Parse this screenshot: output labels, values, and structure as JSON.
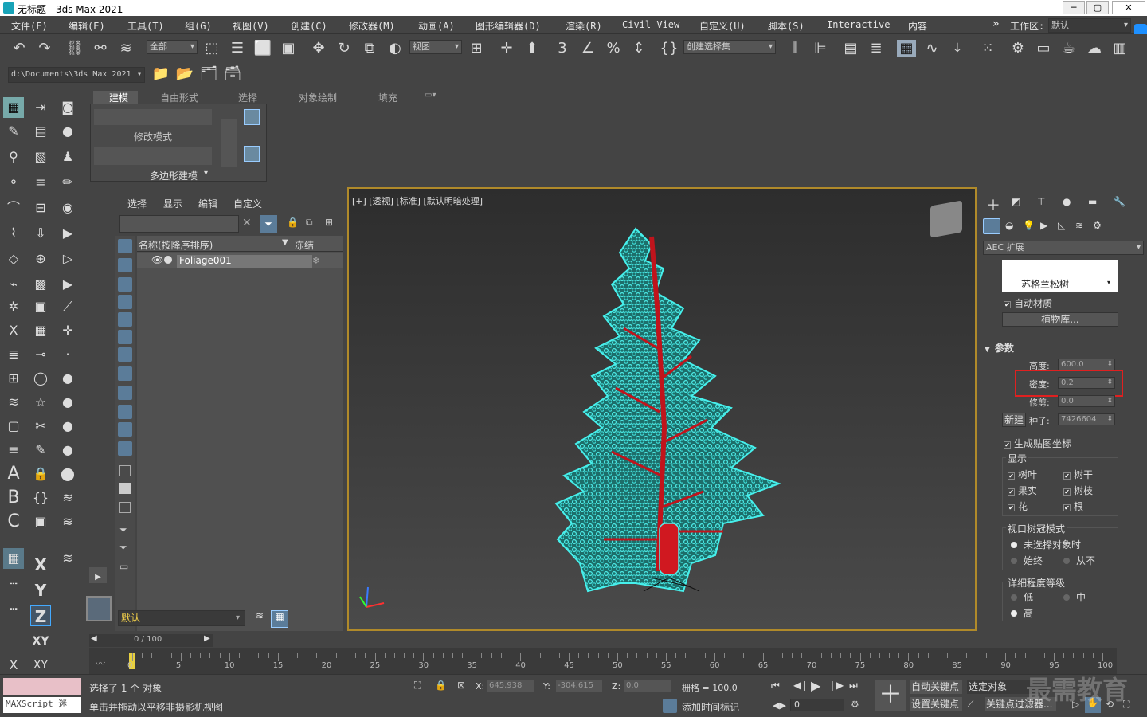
{
  "window": {
    "title": "无标题 - 3ds Max 2021",
    "min": "─",
    "max": "▢",
    "close": "✕"
  },
  "menu": [
    "文件(F)",
    "编辑(E)",
    "工具(T)",
    "组(G)",
    "视图(V)",
    "创建(C)",
    "修改器(M)",
    "动画(A)",
    "图形编辑器(D)",
    "渲染(R)",
    "Civil View",
    "自定义(U)",
    "脚本(S)",
    "Interactive",
    "内容"
  ],
  "workspace": {
    "label": "工作区:",
    "value": "默认"
  },
  "toolbar": {
    "filter": "全部",
    "refcoord": "视图",
    "selset": "创建选择集"
  },
  "path": "d:\\Documents\\3ds Max 2021",
  "ribbon": {
    "tabs": [
      "建模",
      "自由形式",
      "选择",
      "对象绘制",
      "填充"
    ],
    "group1": "修改模式",
    "group2": "多边形建模"
  },
  "scene": {
    "tabs": [
      "选择",
      "显示",
      "编辑",
      "自定义"
    ],
    "col_name": "名称(按降序排序)",
    "col_freeze": "冻结",
    "items": [
      {
        "name": "Foliage001"
      }
    ],
    "layer": "默认"
  },
  "viewport": {
    "label": "[+] [透视] [标准] [默认明暗处理]"
  },
  "cmd": {
    "category": "AEC 扩展",
    "plant": "苏格兰松树",
    "auto_material": "自动材质",
    "library": "植物库...",
    "rollout": "参数",
    "height_label": "高度:",
    "height": "600.0",
    "density_label": "密度:",
    "density": "0.2",
    "prune_label": "修剪:",
    "prune": "0.0",
    "new_label": "新建",
    "seed_label": "种子:",
    "seed": "7426604",
    "gen_map": "生成贴图坐标",
    "display": "显示",
    "leaves": "树叶",
    "trunk": "树干",
    "fruit": "果实",
    "branches": "树枝",
    "flowers": "花",
    "roots": "根",
    "canopy": "视口树冠模式",
    "when_unselected": "未选择对象时",
    "always": "始终",
    "never": "从不",
    "detail": "详细程度等级",
    "low": "低",
    "medium": "中",
    "high": "高"
  },
  "timeline": {
    "frame": "0 / 100",
    "ticks": [
      "0",
      "5",
      "10",
      "15",
      "20",
      "25",
      "30",
      "35",
      "40",
      "45",
      "50",
      "55",
      "60",
      "65",
      "70",
      "75",
      "80",
      "85",
      "90",
      "95",
      "100"
    ]
  },
  "status": {
    "script": "MAXScript 迷",
    "selected": "选择了 1 个 对象",
    "hint": "单击并拖动以平移非摄影机视图",
    "x": "645.938",
    "y": "-304.615",
    "z": "0.0",
    "grid": "栅格 = 100.0",
    "add_time": "添加时间标记",
    "auto_key": "自动关键点",
    "sel_obj": "选定对象",
    "set_key": "设置关键点",
    "key_filter": "关键点过滤器...",
    "frame": "0"
  },
  "watermark": "最需教育"
}
